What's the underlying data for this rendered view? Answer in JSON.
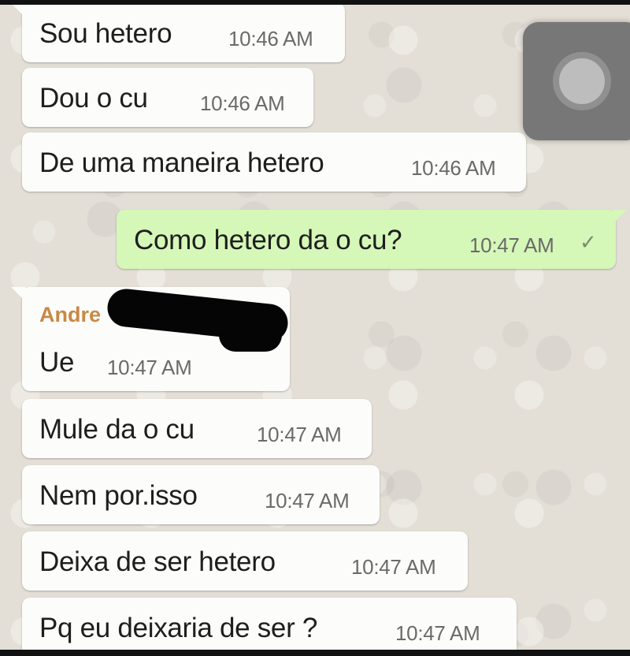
{
  "messages": [
    {
      "text": "Sou hetero",
      "time": "10:46 AM"
    },
    {
      "text": "Dou o cu",
      "time": "10:46 AM"
    },
    {
      "text": "De uma maneira hetero",
      "time": "10:46 AM"
    },
    {
      "text": "Como hetero da o cu?",
      "time": "10:47 AM",
      "status": "✓"
    },
    {
      "sender": "Andre",
      "text": "Ue",
      "time": "10:47 AM"
    },
    {
      "text": "Mule da o cu",
      "time": "10:47 AM"
    },
    {
      "text": "Nem por.isso",
      "time": "10:47 AM"
    },
    {
      "text": "Deixa de ser hetero",
      "time": "10:47 AM"
    },
    {
      "text": "Pq eu deixaria de ser ?",
      "time": "10:47 AM"
    }
  ],
  "colors": {
    "incoming_bubble": "#fcfcfa",
    "outgoing_bubble": "#d5f7b8",
    "sender_name": "#c98846",
    "chat_background": "#e3ded6"
  }
}
